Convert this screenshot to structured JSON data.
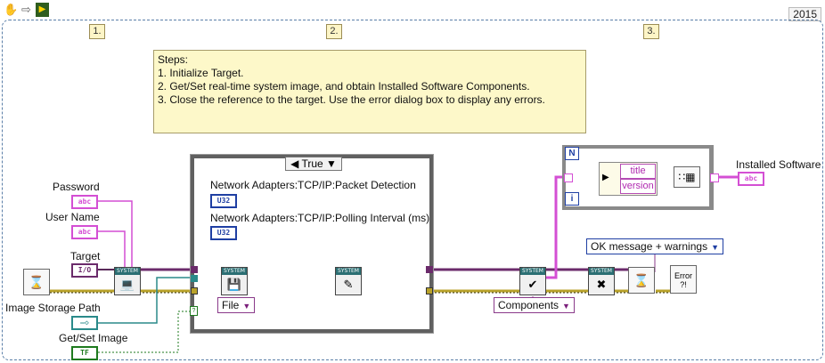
{
  "toolbar": {
    "run_icon": "hand-icon",
    "arrow_icon": "arrow-icon",
    "version": "2015"
  },
  "sequence": {
    "frames": [
      "1.",
      "2.",
      "3."
    ]
  },
  "comment": {
    "lines": [
      "Steps:",
      "1. Initialize Target.",
      "2. Get/Set real-time system image, and obtain Installed Software Components.",
      "3. Close the reference to the target. Use the error dialog box to display any errors."
    ]
  },
  "controls": {
    "password": {
      "label": "Password",
      "tag": "abc"
    },
    "user_name": {
      "label": "User Name",
      "tag": "abc"
    },
    "target": {
      "label": "Target",
      "tag": "I/O"
    },
    "image_storage_path": {
      "label": "Image Storage Path",
      "tag": "path"
    },
    "get_set_image": {
      "label": "Get/Set Image",
      "tag": "TF"
    }
  },
  "case_structure": {
    "selector": "True",
    "packet_detection": {
      "label": "Network Adapters:TCP/IP:Packet Detection",
      "tag": "U32"
    },
    "polling_interval": {
      "label": "Network Adapters:TCP/IP:Polling Interval (ms)",
      "tag": "U32"
    },
    "file_ring": "File"
  },
  "components_ring": "Components",
  "error_ring": "OK message + warnings",
  "loop": {
    "n_terminal": "N",
    "i_terminal": "i",
    "unbundle_fields": [
      "title",
      "version"
    ]
  },
  "indicator": {
    "label": "Installed Software",
    "tag": "abc"
  },
  "error_dialog": "Error ?!",
  "node_header": "SYSTEM",
  "colors": {
    "string_wire": "#d44fd4",
    "refnum_wire": "#5a2a5a",
    "error_wire": "#b9a22a",
    "numeric_wire": "#1f3fa3",
    "path_wire": "#2a8a8a",
    "bool_wire": "#1e7a1e"
  }
}
